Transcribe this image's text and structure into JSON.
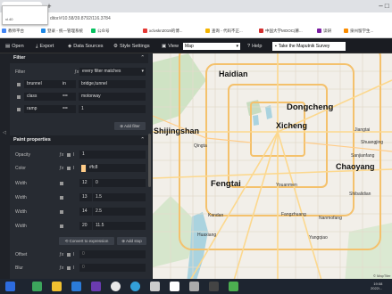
{
  "browser": {
    "url": "ditor/#10.58/39.8792/116.3784",
    "new_tab_label": "+",
    "window_controls": "– □",
    "tab_dropdown_text": "xl.40",
    "bookmarks": [
      {
        "label": "教师平台",
        "color": "#4285f4"
      },
      {
        "label": "登录 - 统一管理系统",
        "color": "#1e88e5"
      },
      {
        "label": "公众号",
        "color": "#07c160"
      },
      {
        "label": "xclvskn2019的博...",
        "color": "#e53935"
      },
      {
        "label": "查询 - 代码不正...",
        "color": "#f4b400"
      },
      {
        "label": "中国大学MOOC(慕...",
        "color": "#d32f2f"
      },
      {
        "label": "读研",
        "color": "#7b1fa2"
      },
      {
        "label": "泉州留学生...",
        "color": "#fb8c00"
      }
    ]
  },
  "toolbar": {
    "open": "Open",
    "export": "Export",
    "data_sources": "Data Sources",
    "style_settings": "Style Settings",
    "view_label": "View",
    "view_value": "Map",
    "help": "Help",
    "survey": "Take the Maputnik Survey"
  },
  "filter": {
    "title": "Filter",
    "label": "Filter",
    "mode": "every filter matches",
    "rows": [
      {
        "field": "brunnel",
        "op": "in",
        "value": "bridge,tunnel"
      },
      {
        "field": "class",
        "op": "==",
        "value": "motorway"
      },
      {
        "field": "ramp",
        "op": "==",
        "value": "1"
      }
    ],
    "add_filter": "Add filter"
  },
  "paint": {
    "title": "Paint properties",
    "opacity_label": "Opacity",
    "opacity_value": "1",
    "color_label": "Color",
    "color_value": "#fc8",
    "color_swatch": "#ffcc88",
    "width_label": "Width",
    "width_stops": [
      {
        "zoom": "12",
        "value": "0"
      },
      {
        "zoom": "13",
        "value": "1.5"
      },
      {
        "zoom": "14",
        "value": "2.5"
      },
      {
        "zoom": "20",
        "value": "11.5"
      }
    ],
    "convert_button": "Convert to expression",
    "add_stop_button": "Add stop",
    "offset_label": "Offset",
    "offset_value": "0",
    "blur_label": "Blur",
    "blur_value": "0"
  },
  "map": {
    "cities": [
      {
        "name": "Haidian"
      },
      {
        "name": "Dongcheng"
      },
      {
        "name": "Shijingshan"
      },
      {
        "name": "Xicheng"
      },
      {
        "name": "Fengtai"
      },
      {
        "name": "Chaoyang"
      }
    ],
    "towns": [
      "Qingta",
      "Youanmen",
      "Kandan",
      "Huaxiang",
      "Fangzhuang",
      "Jiangtai",
      "Shuangjing",
      "Sanjianfang",
      "Nanmofang",
      "Yangqiao",
      "Shibalidian"
    ],
    "attribution": "© MapTiler"
  },
  "taskbar": {
    "time": "19:08",
    "date": "2022/..."
  }
}
